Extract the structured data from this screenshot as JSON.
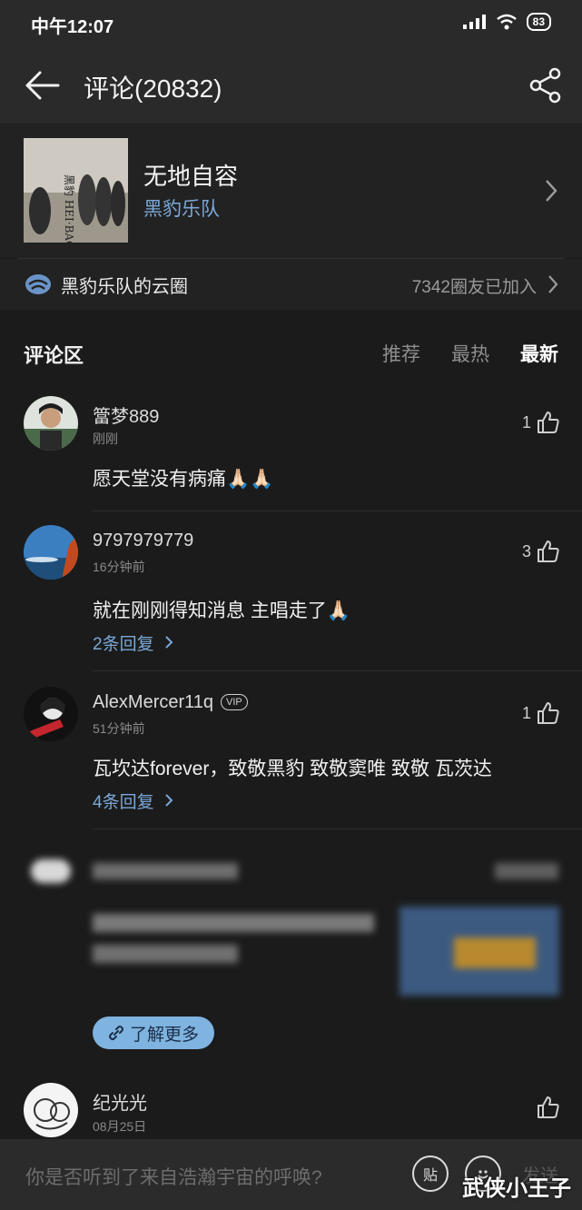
{
  "status": {
    "time": "中午12:07",
    "battery": "83"
  },
  "header": {
    "title": "评论(20832)"
  },
  "song": {
    "title": "无地自容",
    "artist": "黑豹乐队",
    "album_text": "黑豹 HEI·BAO"
  },
  "circle": {
    "name": "黑豹乐队的云圈",
    "count": "7342圈友已加入"
  },
  "comments_section": {
    "title": "评论区",
    "tabs": [
      {
        "label": "推荐",
        "active": false
      },
      {
        "label": "最热",
        "active": false
      },
      {
        "label": "最新",
        "active": true
      }
    ]
  },
  "comments": [
    {
      "name": "簹梦889",
      "time": "刚刚",
      "likes": "1",
      "text": "愿天堂没有病痛🙏🏻🙏🏻",
      "replies": ""
    },
    {
      "name": "9797979779",
      "time": "16分钟前",
      "likes": "3",
      "text": "就在刚刚得知消息 主唱走了🙏🏻",
      "replies": "2条回复"
    },
    {
      "name": "AlexMercer11q",
      "badge": "VIP",
      "time": "51分钟前",
      "likes": "1",
      "text": "瓦坎达forever，致敬黑豹 致敬窦唯 致敬 瓦茨达",
      "replies": "4条回复"
    },
    {
      "name": "纪光光",
      "time": "08月25日",
      "likes": "",
      "text": "",
      "replies": ""
    }
  ],
  "ad": {
    "learn_more": "了解更多"
  },
  "input": {
    "placeholder": "你是否听到了来自浩瀚宇宙的呼唤?",
    "paste_label": "贴",
    "send_label": "发送"
  },
  "watermark": "武侠小王子",
  "colors": {
    "accent_blue": "#7aa8d8",
    "background": "#1b1b1b"
  }
}
